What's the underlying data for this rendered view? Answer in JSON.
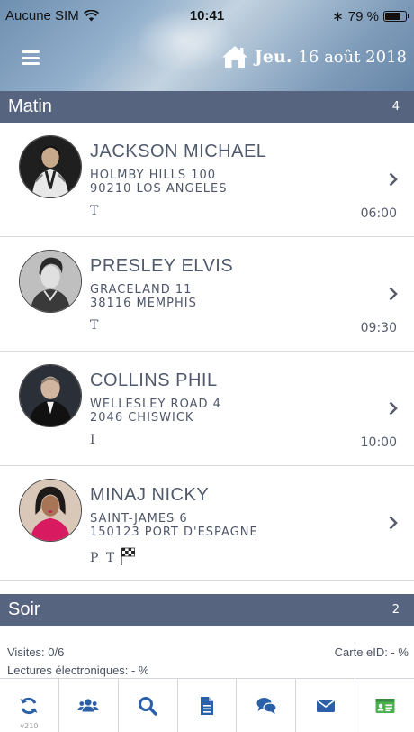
{
  "status_bar": {
    "carrier": "Aucune SIM",
    "time": "10:41",
    "bluetooth": "∗",
    "battery": "79 %",
    "battery_level": 0.79
  },
  "header": {
    "day": "Jeu.",
    "date": "16 août 2018"
  },
  "sections": [
    {
      "title": "Matin",
      "count": "4"
    },
    {
      "title": "Soir",
      "count": "2"
    }
  ],
  "visits": [
    {
      "name": "JACKSON MICHAEL",
      "address_line1": "HOLMBY HILLS 100",
      "address_line2": "90210 LOS ANGELES",
      "code": "T",
      "time": "06:00",
      "avatar_bg": "#1f1f1f"
    },
    {
      "name": "PRESLEY ELVIS",
      "address_line1": "GRACELAND 11",
      "address_line2": "38116 MEMPHIS",
      "code": "T",
      "time": "09:30",
      "avatar_bg": "#bfbfbf"
    },
    {
      "name": "COLLINS PHIL",
      "address_line1": "WELLESLEY ROAD 4",
      "address_line2": "2046 CHISWICK",
      "code": "I",
      "time": "10:00",
      "avatar_bg": "#2b3038"
    },
    {
      "name": "MINAJ NICKY",
      "address_line1": "SAINT-JAMES 6",
      "address_line2": "150123 PORT D'ESPAGNE",
      "code": "P T",
      "time": "",
      "avatar_bg": "#d9c8b8"
    }
  ],
  "summary": {
    "visits": "Visites: 0/6",
    "eid": "Carte eID: - %",
    "readings": "Lectures électroniques: - %"
  },
  "tabbar": {
    "version": "v210",
    "tabs": [
      {
        "icon": "sync-icon",
        "color": "#2b5fa8"
      },
      {
        "icon": "users-icon",
        "color": "#2b5fa8"
      },
      {
        "icon": "search-icon",
        "color": "#2b5fa8"
      },
      {
        "icon": "document-icon",
        "color": "#2b5fa8"
      },
      {
        "icon": "chat-icon",
        "color": "#2b5fa8"
      },
      {
        "icon": "mail-icon",
        "color": "#2b5fa8"
      },
      {
        "icon": "id-card-icon",
        "color": "#4caf50"
      }
    ]
  },
  "colors": {
    "section_header": "#56647f",
    "accent_blue": "#2b5fa8",
    "accent_green": "#4caf50"
  }
}
